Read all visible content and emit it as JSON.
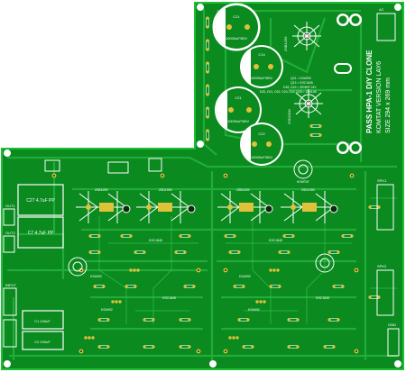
{
  "colors": {
    "board": "#0a8a1f",
    "board_dark": "#067318",
    "trace": "#2bb53f",
    "silk": "#ffffff",
    "pad": "#e0c23a",
    "hole": "#0b2a0b",
    "mount_hole": "#ffffff"
  },
  "title": {
    "line1": "PASS HPA-1 DIY CLONE",
    "line2": "KOMTAT VERSION LAY6",
    "line3": "SIZE 294 x 269 mm"
  },
  "caps": {
    "c_top": {
      "label": "C21",
      "value": "10000uF/50V"
    },
    "c_right_top": {
      "label": "C14",
      "value": "10000uF/50V"
    },
    "c_mid": {
      "label": "C21",
      "value": "10000uF/50V"
    },
    "c_right_bottom": {
      "label": "C22",
      "value": "10000uF/50V"
    }
  },
  "left_caps": {
    "top": "C27 4.7uF PP",
    "bottom": "C7 4.7uF PP",
    "small1": "C1 100uF",
    "small2": "C2 100uF"
  },
  "transistors": {
    "q_right_1": "2SB1259",
    "q_right_2": "2SD1900",
    "reg_text_1": "Q21 = KSA992",
    "reg_text_2": "Q13 = KSC1845",
    "reg_text_3": "D18, D19 = ZENER 24V",
    "reg_text_4": "D20, D21, D22, D23, D24, D25 = 1N4148",
    "heatsink_labels": [
      "2SB1259",
      "2SD1900",
      "2SB1259",
      "2SD1900"
    ]
  },
  "small_parts": {
    "ksc_labels": [
      "KSC1845",
      "KSC1845",
      "KSC1845",
      "KSC1845"
    ],
    "ksa_labels": [
      "KSA992",
      "KSA992",
      "KSA992",
      "KSA992"
    ],
    "connectors": {
      "out1": "OUT1",
      "out2": "OUT2",
      "input": "INPUT",
      "spk1": "SPK1",
      "spk2": "SPK2",
      "ac": "AC",
      "gnd": "GND"
    },
    "logo_text": "KOMTAT"
  }
}
